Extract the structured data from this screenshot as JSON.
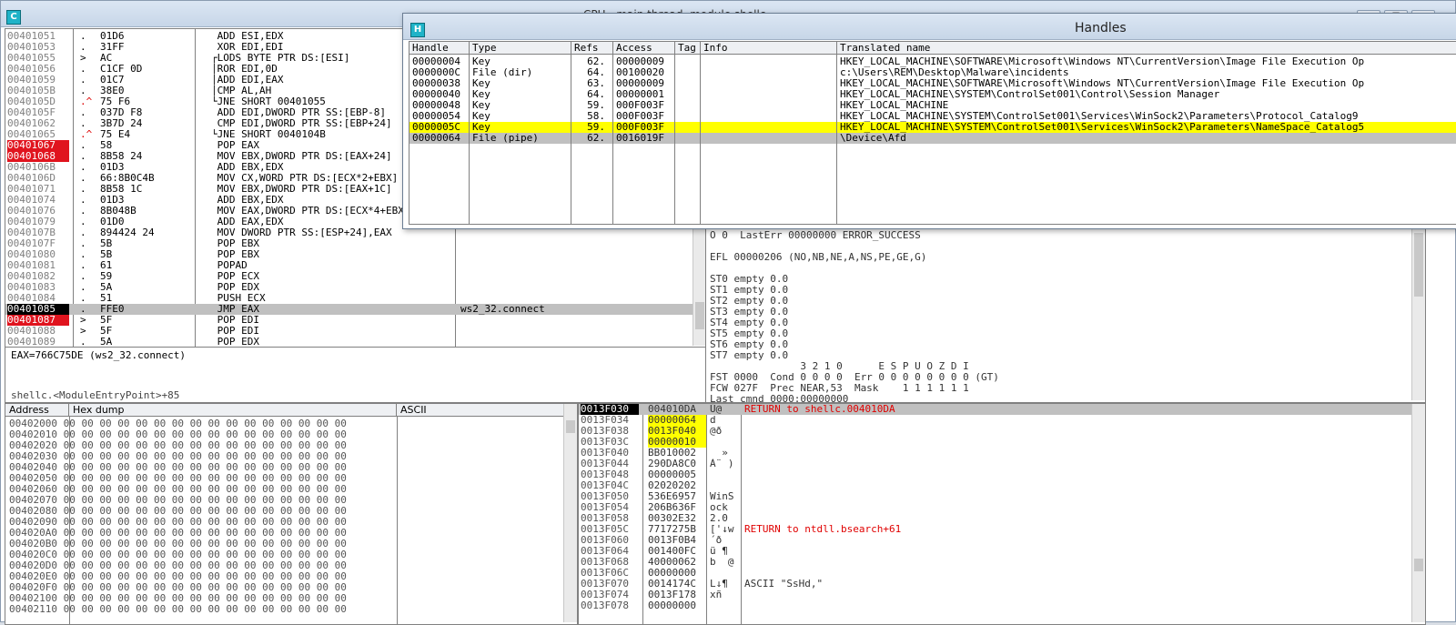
{
  "cpu_window": {
    "icon_letter": "C",
    "title": "CPU - main thread, module shellc",
    "btn_minimize": "—",
    "btn_maximize": "☐",
    "btn_close": "✕"
  },
  "disasm_rows": [
    {
      "addr": "00401051",
      "mark": ".",
      "hex": "01D6",
      "asm": " ADD ESI,EDX",
      "cmt": "",
      "addr_style": ""
    },
    {
      "addr": "00401053",
      "mark": ".",
      "hex": "31FF",
      "asm": " XOR EDI,EDI",
      "cmt": "",
      "addr_style": ""
    },
    {
      "addr": "00401055",
      "mark": ">",
      "hex": "AC",
      "asm": "┌LODS BYTE PTR DS:[ESI]",
      "cmt": "",
      "addr_style": ""
    },
    {
      "addr": "00401056",
      "mark": ".",
      "hex": "C1CF 0D",
      "asm": "│ROR EDI,0D",
      "cmt": "",
      "addr_style": ""
    },
    {
      "addr": "00401059",
      "mark": ".",
      "hex": "01C7",
      "asm": "│ADD EDI,EAX",
      "cmt": "",
      "addr_style": ""
    },
    {
      "addr": "0040105B",
      "mark": ".",
      "hex": "38E0",
      "asm": "│CMP AL,AH",
      "cmt": "",
      "addr_style": ""
    },
    {
      "addr": "0040105D",
      "mark": ".^",
      "hex": "75 F6",
      "asm": "└JNE SHORT 00401055",
      "cmt": "",
      "addr_style": ""
    },
    {
      "addr": "0040105F",
      "mark": ".",
      "hex": "037D F8",
      "asm": " ADD EDI,DWORD PTR SS:[EBP-8]",
      "cmt": "",
      "addr_style": ""
    },
    {
      "addr": "00401062",
      "mark": ".",
      "hex": "3B7D 24",
      "asm": " CMP EDI,DWORD PTR SS:[EBP+24]",
      "cmt": "",
      "addr_style": ""
    },
    {
      "addr": "00401065",
      "mark": ".^",
      "hex": "75 E4",
      "asm": "└JNE SHORT 0040104B",
      "cmt": "",
      "addr_style": ""
    },
    {
      "addr": "00401067",
      "mark": ".",
      "hex": "58",
      "asm": " POP EAX",
      "cmt": "",
      "addr_style": "bp"
    },
    {
      "addr": "00401068",
      "mark": ".",
      "hex": "8B58 24",
      "asm": " MOV EBX,DWORD PTR DS:[EAX+24]",
      "cmt": "",
      "addr_style": "bp"
    },
    {
      "addr": "0040106B",
      "mark": ".",
      "hex": "01D3",
      "asm": " ADD EBX,EDX",
      "cmt": "",
      "addr_style": ""
    },
    {
      "addr": "0040106D",
      "mark": ".",
      "hex": "66:8B0C4B",
      "asm": " MOV CX,WORD PTR DS:[ECX*2+EBX]",
      "cmt": "",
      "addr_style": ""
    },
    {
      "addr": "00401071",
      "mark": ".",
      "hex": "8B58 1C",
      "asm": " MOV EBX,DWORD PTR DS:[EAX+1C]",
      "cmt": "",
      "addr_style": ""
    },
    {
      "addr": "00401074",
      "mark": ".",
      "hex": "01D3",
      "asm": " ADD EBX,EDX",
      "cmt": "",
      "addr_style": ""
    },
    {
      "addr": "00401076",
      "mark": ".",
      "hex": "8B048B",
      "asm": " MOV EAX,DWORD PTR DS:[ECX*4+EBX]",
      "cmt": "",
      "addr_style": ""
    },
    {
      "addr": "00401079",
      "mark": ".",
      "hex": "01D0",
      "asm": " ADD EAX,EDX",
      "cmt": "",
      "addr_style": ""
    },
    {
      "addr": "0040107B",
      "mark": ".",
      "hex": "894424 24",
      "asm": " MOV DWORD PTR SS:[ESP+24],EAX",
      "cmt": "",
      "addr_style": ""
    },
    {
      "addr": "0040107F",
      "mark": ".",
      "hex": "5B",
      "asm": " POP EBX",
      "cmt": "",
      "addr_style": ""
    },
    {
      "addr": "00401080",
      "mark": ".",
      "hex": "5B",
      "asm": " POP EBX",
      "cmt": "",
      "addr_style": ""
    },
    {
      "addr": "00401081",
      "mark": ".",
      "hex": "61",
      "asm": " POPAD",
      "cmt": "",
      "addr_style": ""
    },
    {
      "addr": "00401082",
      "mark": ".",
      "hex": "59",
      "asm": " POP ECX",
      "cmt": "",
      "addr_style": ""
    },
    {
      "addr": "00401083",
      "mark": ".",
      "hex": "5A",
      "asm": " POP EDX",
      "cmt": "",
      "addr_style": ""
    },
    {
      "addr": "00401084",
      "mark": ".",
      "hex": "51",
      "asm": " PUSH ECX",
      "cmt": "",
      "addr_style": ""
    },
    {
      "addr": "00401085",
      "mark": ".",
      "hex": "FFE0",
      "asm": " JMP EAX",
      "cmt": "ws2_32.connect",
      "addr_style": "bpcur"
    },
    {
      "addr": "00401087",
      "mark": ">",
      "hex": "5F",
      "asm": " POP EDI",
      "cmt": "",
      "addr_style": "bp"
    },
    {
      "addr": "00401088",
      "mark": ">",
      "hex": "5F",
      "asm": " POP EDI",
      "cmt": "",
      "addr_style": ""
    },
    {
      "addr": "00401089",
      "mark": ".",
      "hex": "5A",
      "asm": " POP EDX",
      "cmt": "",
      "addr_style": ""
    }
  ],
  "disasm_selected_index": 25,
  "info_pane": {
    "line1": "EAX=766C75DE (ws2_32.connect)",
    "line2": "shellc.<ModuleEntryPoint>+85"
  },
  "registers": [
    "O 0  LastErr 00000000 ERROR_SUCCESS",
    "",
    "EFL 00000206 (NO,NB,NE,A,NS,PE,GE,G)",
    "",
    "ST0 empty 0.0",
    "ST1 empty 0.0",
    "ST2 empty 0.0",
    "ST3 empty 0.0",
    "ST4 empty 0.0",
    "ST5 empty 0.0",
    "ST6 empty 0.0",
    "ST7 empty 0.0",
    "               3 2 1 0      E S P U O Z D I",
    "FST 0000  Cond 0 0 0 0  Err 0 0 0 0 0 0 0 0 (GT)",
    "FCW 027F  Prec NEAR,53  Mask    1 1 1 1 1 1",
    "Last cmnd 0000:00000000"
  ],
  "dump": {
    "headers": {
      "address": "Address",
      "hex": "Hex dump",
      "ascii": "ASCII"
    },
    "rows": [
      "00402000 00 00 00 00 00 00 00 00 00 00 00 00 00 00 00 00",
      "00402010 00 00 00 00 00 00 00 00 00 00 00 00 00 00 00 00",
      "00402020 00 00 00 00 00 00 00 00 00 00 00 00 00 00 00 00",
      "00402030 00 00 00 00 00 00 00 00 00 00 00 00 00 00 00 00",
      "00402040 00 00 00 00 00 00 00 00 00 00 00 00 00 00 00 00",
      "00402050 00 00 00 00 00 00 00 00 00 00 00 00 00 00 00 00",
      "00402060 00 00 00 00 00 00 00 00 00 00 00 00 00 00 00 00",
      "00402070 00 00 00 00 00 00 00 00 00 00 00 00 00 00 00 00",
      "00402080 00 00 00 00 00 00 00 00 00 00 00 00 00 00 00 00",
      "00402090 00 00 00 00 00 00 00 00 00 00 00 00 00 00 00 00",
      "004020A0 00 00 00 00 00 00 00 00 00 00 00 00 00 00 00 00",
      "004020B0 00 00 00 00 00 00 00 00 00 00 00 00 00 00 00 00",
      "004020C0 00 00 00 00 00 00 00 00 00 00 00 00 00 00 00 00",
      "004020D0 00 00 00 00 00 00 00 00 00 00 00 00 00 00 00 00",
      "004020E0 00 00 00 00 00 00 00 00 00 00 00 00 00 00 00 00",
      "004020F0 00 00 00 00 00 00 00 00 00 00 00 00 00 00 00 00",
      "00402100 00 00 00 00 00 00 00 00 00 00 00 00 00 00 00 00",
      "00402110 00 00 00 00 00 00 00 00 00 00 00 00 00 00 00 00"
    ]
  },
  "stack_rows": [
    {
      "addr": "0013F030",
      "val": "004010DA",
      "asc": "Ú@",
      "cmt": "RETURN to shellc.004010DA",
      "cur": true,
      "hl": false,
      "plain": false
    },
    {
      "addr": "0013F034",
      "val": "00000064",
      "asc": "d",
      "cmt": "",
      "cur": false,
      "hl": true,
      "plain": false
    },
    {
      "addr": "0013F038",
      "val": "0013F040",
      "asc": "@ð",
      "cmt": "",
      "cur": false,
      "hl": true,
      "plain": false
    },
    {
      "addr": "0013F03C",
      "val": "00000010",
      "asc": "",
      "cmt": "",
      "cur": false,
      "hl": true,
      "plain": false
    },
    {
      "addr": "0013F040",
      "val": "BB010002",
      "asc": "  »",
      "cmt": "",
      "cur": false,
      "hl": false,
      "plain": false
    },
    {
      "addr": "0013F044",
      "val": "290DA8C0",
      "asc": "À¨ )",
      "cmt": "",
      "cur": false,
      "hl": false,
      "plain": false
    },
    {
      "addr": "0013F048",
      "val": "00000005",
      "asc": "",
      "cmt": "",
      "cur": false,
      "hl": false,
      "plain": false
    },
    {
      "addr": "0013F04C",
      "val": "02020202",
      "asc": "",
      "cmt": "",
      "cur": false,
      "hl": false,
      "plain": false
    },
    {
      "addr": "0013F050",
      "val": "536E6957",
      "asc": "WinS",
      "cmt": "",
      "cur": false,
      "hl": false,
      "plain": false
    },
    {
      "addr": "0013F054",
      "val": "206B636F",
      "asc": "ock",
      "cmt": "",
      "cur": false,
      "hl": false,
      "plain": false
    },
    {
      "addr": "0013F058",
      "val": "00302E32",
      "asc": "2.0",
      "cmt": "",
      "cur": false,
      "hl": false,
      "plain": false
    },
    {
      "addr": "0013F05C",
      "val": "7717275B",
      "asc": "['↓w",
      "cmt": "RETURN to ntdll.bsearch+61",
      "cur": false,
      "hl": false,
      "plain": false
    },
    {
      "addr": "0013F060",
      "val": "0013F0B4",
      "asc": "´ð",
      "cmt": "",
      "cur": false,
      "hl": false,
      "plain": false
    },
    {
      "addr": "0013F064",
      "val": "001400FC",
      "asc": "ü ¶",
      "cmt": "",
      "cur": false,
      "hl": false,
      "plain": false
    },
    {
      "addr": "0013F068",
      "val": "40000062",
      "asc": "b  @",
      "cmt": "",
      "cur": false,
      "hl": false,
      "plain": false
    },
    {
      "addr": "0013F06C",
      "val": "00000000",
      "asc": "",
      "cmt": "",
      "cur": false,
      "hl": false,
      "plain": false
    },
    {
      "addr": "0013F070",
      "val": "0014174C",
      "asc": "L↓¶",
      "cmt": "ASCII \"SsHd,\"",
      "cur": false,
      "hl": false,
      "plain": true
    },
    {
      "addr": "0013F074",
      "val": "0013F178",
      "asc": "xñ",
      "cmt": "",
      "cur": false,
      "hl": false,
      "plain": false
    },
    {
      "addr": "0013F078",
      "val": "00000000",
      "asc": "",
      "cmt": "",
      "cur": false,
      "hl": false,
      "plain": false
    }
  ],
  "handles_window": {
    "icon_letter": "H",
    "title": "Handles",
    "columns": [
      "Handle",
      "Type",
      "Refs",
      "Access",
      "Tag",
      "Info",
      "Translated name"
    ],
    "rows": [
      {
        "handle": "00000004",
        "type": "Key",
        "refs": "62.",
        "access": "00000009",
        "tag": "",
        "info": "",
        "name": "HKEY_LOCAL_MACHINE\\SOFTWARE\\Microsoft\\Windows NT\\CurrentVersion\\Image File Execution Op",
        "style": ""
      },
      {
        "handle": "0000000C",
        "type": "File (dir)",
        "refs": "64.",
        "access": "00100020",
        "tag": "",
        "info": "",
        "name": "c:\\Users\\REM\\Desktop\\Malware\\incidents",
        "style": ""
      },
      {
        "handle": "00000038",
        "type": "Key",
        "refs": "63.",
        "access": "00000009",
        "tag": "",
        "info": "",
        "name": "HKEY_LOCAL_MACHINE\\SOFTWARE\\Microsoft\\Windows NT\\CurrentVersion\\Image File Execution Op",
        "style": ""
      },
      {
        "handle": "00000040",
        "type": "Key",
        "refs": "64.",
        "access": "00000001",
        "tag": "",
        "info": "",
        "name": "HKEY_LOCAL_MACHINE\\SYSTEM\\ControlSet001\\Control\\Session Manager",
        "style": ""
      },
      {
        "handle": "00000048",
        "type": "Key",
        "refs": "59.",
        "access": "000F003F",
        "tag": "",
        "info": "",
        "name": "HKEY_LOCAL_MACHINE",
        "style": ""
      },
      {
        "handle": "00000054",
        "type": "Key",
        "refs": "58.",
        "access": "000F003F",
        "tag": "",
        "info": "",
        "name": "HKEY_LOCAL_MACHINE\\SYSTEM\\ControlSet001\\Services\\WinSock2\\Parameters\\Protocol_Catalog9",
        "style": ""
      },
      {
        "handle": "0000005C",
        "type": "Key",
        "refs": "59.",
        "access": "000F003F",
        "tag": "",
        "info": "",
        "name": "HKEY_LOCAL_MACHINE\\SYSTEM\\ControlSet001\\Services\\WinSock2\\Parameters\\NameSpace_Catalog5",
        "style": "yel"
      },
      {
        "handle": "00000064",
        "type": "File (pipe)",
        "refs": "62.",
        "access": "0016019F",
        "tag": "",
        "info": "",
        "name": "\\Device\\Afd",
        "style": "sel"
      }
    ]
  }
}
